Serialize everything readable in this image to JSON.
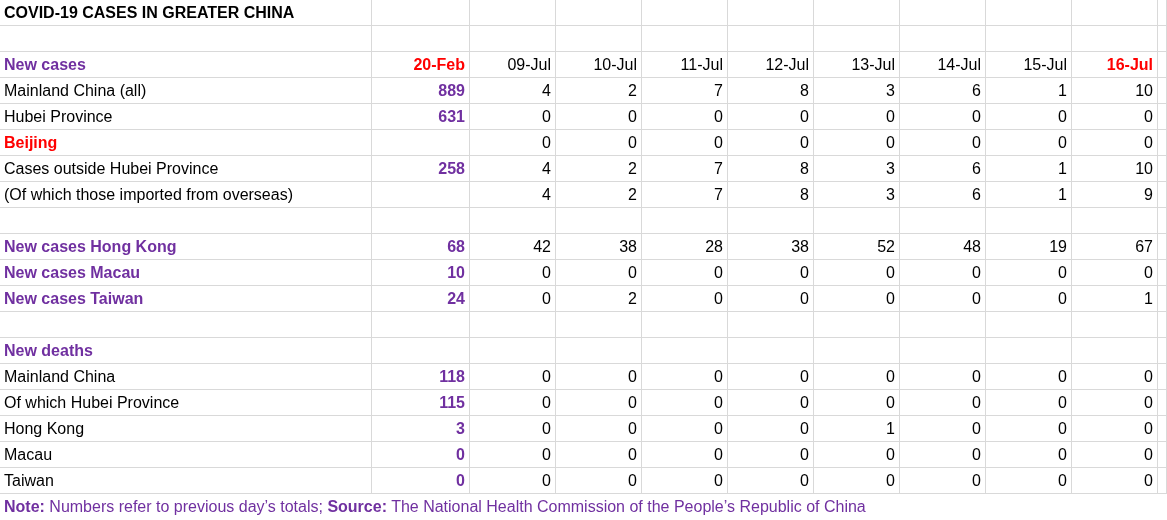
{
  "title": "COVID-19 CASES IN GREATER CHINA",
  "header": {
    "label": "New cases",
    "color": "#7030a0",
    "bold": true,
    "columns": [
      {
        "label": "20-Feb",
        "highlight": true
      },
      {
        "label": "09-Jul",
        "highlight": false
      },
      {
        "label": "10-Jul",
        "highlight": false
      },
      {
        "label": "11-Jul",
        "highlight": false
      },
      {
        "label": "12-Jul",
        "highlight": false
      },
      {
        "label": "13-Jul",
        "highlight": false
      },
      {
        "label": "14-Jul",
        "highlight": false
      },
      {
        "label": "15-Jul",
        "highlight": false
      },
      {
        "label": "16-Jul",
        "highlight": true
      }
    ]
  },
  "rows": [
    {
      "kind": "data",
      "label": "Mainland China (all)",
      "color": "#000000",
      "bold": false,
      "baseline": "889",
      "values": [
        "4",
        "2",
        "7",
        "8",
        "3",
        "6",
        "1",
        "10"
      ]
    },
    {
      "kind": "data",
      "label": "Hubei Province",
      "color": "#000000",
      "bold": false,
      "baseline": "631",
      "values": [
        "0",
        "0",
        "0",
        "0",
        "0",
        "0",
        "0",
        "0"
      ]
    },
    {
      "kind": "data",
      "label": "Beijing",
      "color": "#ff0000",
      "bold": true,
      "values": [
        "0",
        "0",
        "0",
        "0",
        "0",
        "0",
        "0",
        "0"
      ]
    },
    {
      "kind": "data",
      "label": "Cases outside Hubei Province",
      "color": "#000000",
      "bold": false,
      "baseline": "258",
      "values": [
        "4",
        "2",
        "7",
        "8",
        "3",
        "6",
        "1",
        "10"
      ]
    },
    {
      "kind": "data",
      "label": "(Of which those imported from overseas)",
      "color": "#000000",
      "bold": false,
      "values": [
        "4",
        "2",
        "7",
        "8",
        "3",
        "6",
        "1",
        "9"
      ]
    },
    {
      "kind": "blank"
    },
    {
      "kind": "data",
      "label": "New cases Hong Kong",
      "color": "#7030a0",
      "bold": true,
      "baseline": "68",
      "values": [
        "42",
        "38",
        "28",
        "38",
        "52",
        "48",
        "19",
        "67"
      ]
    },
    {
      "kind": "data",
      "label": "New cases Macau",
      "color": "#7030a0",
      "bold": true,
      "baseline": "10",
      "values": [
        "0",
        "0",
        "0",
        "0",
        "0",
        "0",
        "0",
        "0"
      ]
    },
    {
      "kind": "data",
      "label": "New cases Taiwan",
      "color": "#7030a0",
      "bold": true,
      "baseline": "24",
      "values": [
        "0",
        "2",
        "0",
        "0",
        "0",
        "0",
        "0",
        "1"
      ]
    },
    {
      "kind": "blank"
    },
    {
      "kind": "data",
      "label": "New deaths",
      "color": "#7030a0",
      "bold": true,
      "values": []
    },
    {
      "kind": "data",
      "label": "Mainland China",
      "color": "#000000",
      "bold": false,
      "baseline": "118",
      "values": [
        "0",
        "0",
        "0",
        "0",
        "0",
        "0",
        "0",
        "0"
      ]
    },
    {
      "kind": "data",
      "label": "Of which Hubei Province",
      "color": "#000000",
      "bold": false,
      "baseline": "115",
      "values": [
        "0",
        "0",
        "0",
        "0",
        "0",
        "0",
        "0",
        "0"
      ]
    },
    {
      "kind": "data",
      "label": "Hong Kong",
      "color": "#000000",
      "bold": false,
      "baseline": "3",
      "values": [
        "0",
        "0",
        "0",
        "0",
        "1",
        "0",
        "0",
        "0"
      ]
    },
    {
      "kind": "data",
      "label": "Macau",
      "color": "#000000",
      "bold": false,
      "baseline": "0",
      "values": [
        "0",
        "0",
        "0",
        "0",
        "0",
        "0",
        "0",
        "0"
      ]
    },
    {
      "kind": "data",
      "label": "Taiwan",
      "color": "#000000",
      "bold": false,
      "baseline": "0",
      "values": [
        "0",
        "0",
        "0",
        "0",
        "0",
        "0",
        "0",
        "0"
      ]
    }
  ],
  "note": "**Note:** Numbers refer to previous day’s totals; **Source:** The National Health Commission of the People’s Republic of China"
}
